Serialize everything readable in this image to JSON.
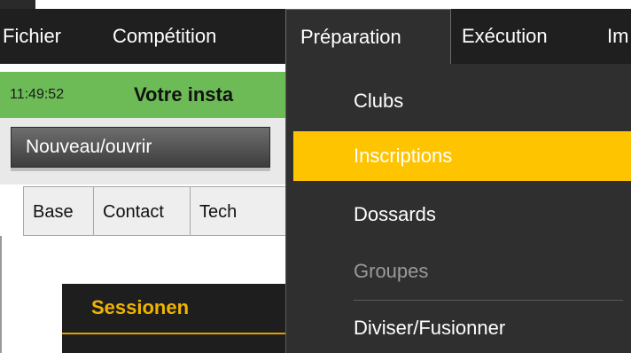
{
  "menubar": {
    "items": [
      {
        "label": "Fichier"
      },
      {
        "label": "Compétition"
      },
      {
        "label": "Préparation",
        "open": true
      },
      {
        "label": "Exécution"
      },
      {
        "label": "Im"
      }
    ]
  },
  "status": {
    "time": "11:49:52",
    "message": "Votre insta"
  },
  "toolbar": {
    "new_open_label": "Nouveau/ouvrir"
  },
  "tabs": [
    {
      "label": "Base"
    },
    {
      "label": "Contact"
    },
    {
      "label": "Tech"
    }
  ],
  "sessions": {
    "title": "Sessionen"
  },
  "dropdown": {
    "items": [
      {
        "label": "Clubs",
        "state": "normal"
      },
      {
        "label": "Inscriptions",
        "state": "selected"
      },
      {
        "label": "Dossards",
        "state": "normal"
      },
      {
        "label": "Groupes",
        "state": "disabled"
      },
      {
        "label": "Diviser/Fusionner",
        "state": "normal"
      }
    ]
  },
  "colors": {
    "menubar_bg": "#1f1f1f",
    "status_green": "#6dbb56",
    "selected_yellow": "#ffc400",
    "sessions_title": "#f0b400"
  }
}
